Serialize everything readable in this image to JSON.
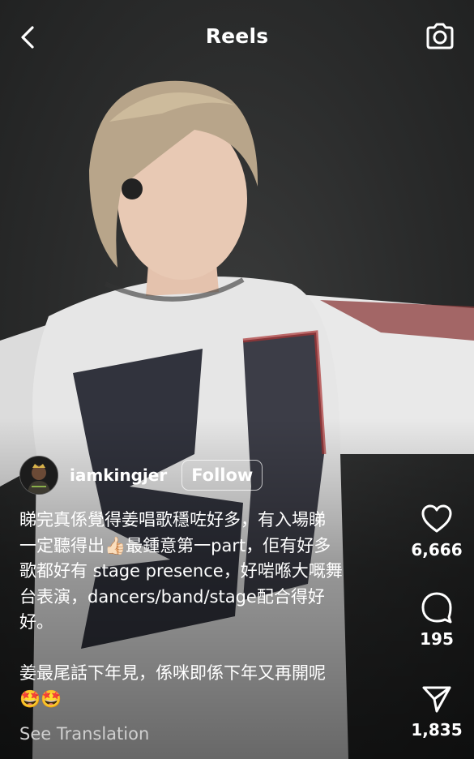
{
  "header": {
    "title": "Reels"
  },
  "author": {
    "username": "iamkingjer",
    "follow_label": "Follow"
  },
  "caption": {
    "lines": [
      "睇完真係覺得姜唱歌穩咗好多，有入場睇",
      "一定聽得出👍🏻最鍾意第一part，佢有好多",
      "歌都好有 stage presence，好啱喺大嘅舞",
      "台表演，dancers/band/stage配合得好",
      "好。",
      "",
      "姜最尾話下年見，係咪即係下年又再開呢",
      "🤩🤩"
    ],
    "see_translation": "See Translation"
  },
  "actions": {
    "likes": "6,666",
    "comments": "195",
    "shares": "1,835"
  },
  "icons": {
    "back": "chevron-left-icon",
    "camera": "camera-icon",
    "like": "heart-icon",
    "comment": "comment-bubble-icon",
    "share": "paper-plane-icon"
  }
}
